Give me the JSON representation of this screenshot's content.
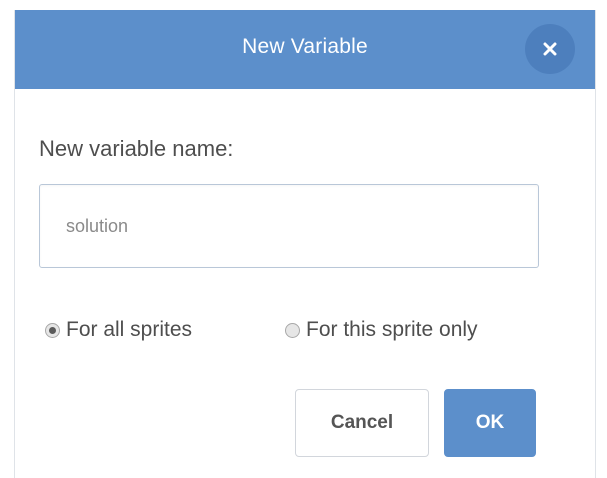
{
  "dialog": {
    "title": "New Variable",
    "close_icon": "close-icon"
  },
  "form": {
    "label": "New variable name:",
    "input_value": "",
    "input_placeholder": "solution",
    "scope_options": [
      {
        "label": "For all sprites",
        "checked": true
      },
      {
        "label": "For this sprite only",
        "checked": false
      }
    ]
  },
  "buttons": {
    "cancel": "Cancel",
    "ok": "OK"
  },
  "colors": {
    "header": "#5c8fcb",
    "close_button": "#4d7fbd",
    "ok_button": "#5c8fcb"
  }
}
